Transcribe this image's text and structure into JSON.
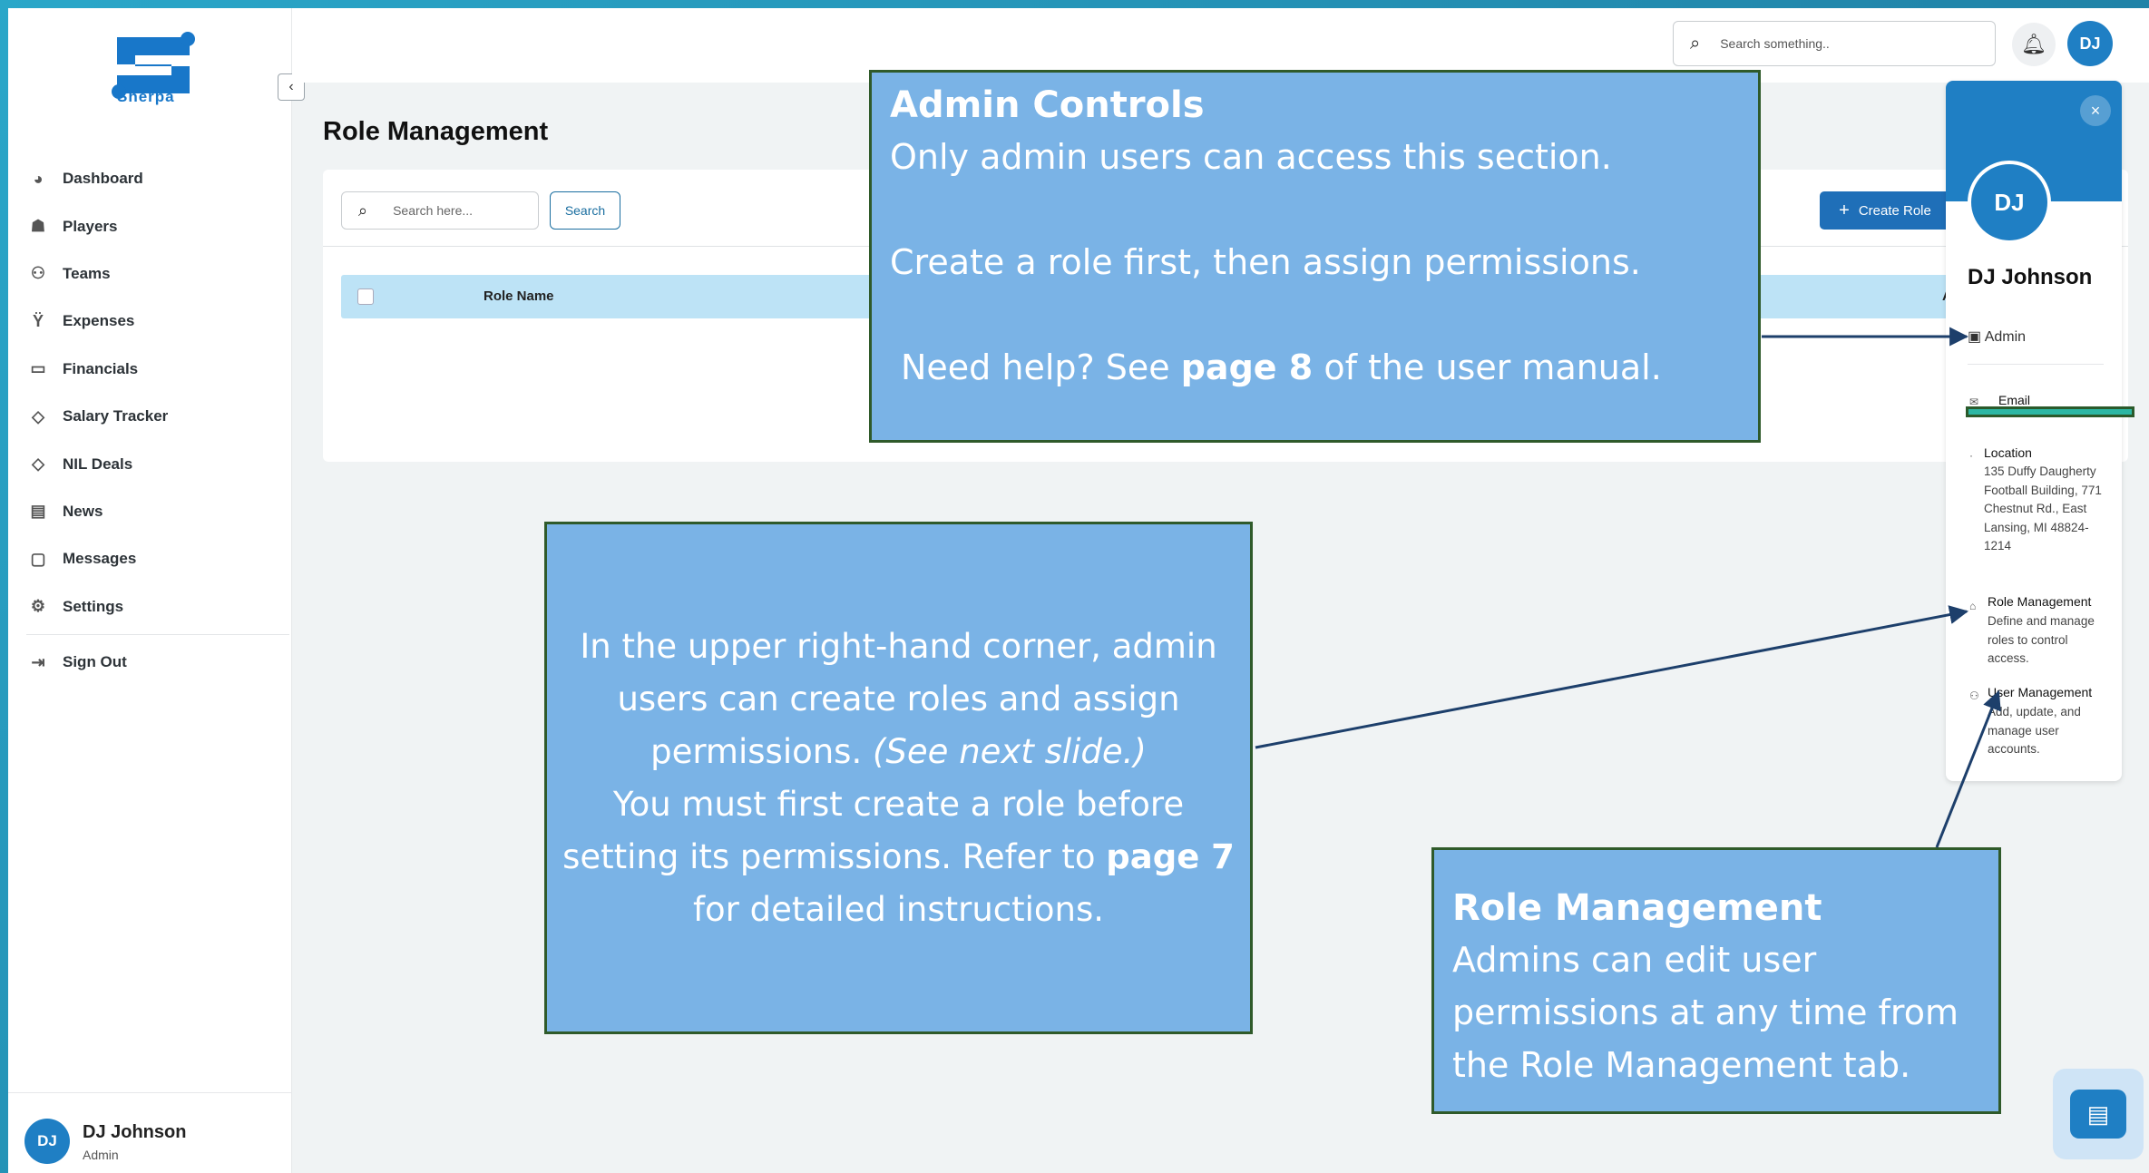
{
  "brand": {
    "name": "Sherpa",
    "color": "#1877c9"
  },
  "sidebar": {
    "collapse_icon": "chevron-left-icon",
    "items": [
      {
        "label": "Dashboard",
        "icon": "dashboard-icon"
      },
      {
        "label": "Players",
        "icon": "players-icon"
      },
      {
        "label": "Teams",
        "icon": "teams-icon"
      },
      {
        "label": "Expenses",
        "icon": "expenses-icon"
      },
      {
        "label": "Financials",
        "icon": "financials-icon"
      },
      {
        "label": "Salary Tracker",
        "icon": "handshake-icon"
      },
      {
        "label": "NIL Deals",
        "icon": "handshake-icon"
      },
      {
        "label": "News",
        "icon": "news-icon"
      },
      {
        "label": "Messages",
        "icon": "messages-icon"
      },
      {
        "label": "Settings",
        "icon": "gear-icon"
      }
    ],
    "sign_out": "Sign Out",
    "user": {
      "initials": "DJ",
      "name": "DJ Johnson",
      "role": "Admin"
    }
  },
  "topbar": {
    "search_placeholder": "Search something..",
    "avatar_initials": "DJ"
  },
  "main": {
    "title": "Role Management",
    "search_placeholder": "Search here...",
    "search_button": "Search",
    "create_button": "Create Role",
    "table": {
      "columns": [
        "Role Name",
        "A"
      ]
    }
  },
  "profile": {
    "initials": "DJ",
    "name": "DJ Johnson",
    "role": "Admin",
    "email_label": "Email",
    "location_label": "Location",
    "location": "135 Duffy Daugherty Football Building, 771 Chestnut Rd., East Lansing, MI 48824-1214",
    "role_mgmt_label": "Role Management",
    "role_mgmt_desc": "Define and manage roles to control access.",
    "user_mgmt_label": "User Management",
    "user_mgmt_desc": "Add, update, and manage user accounts."
  },
  "callouts": {
    "admin": {
      "title": "Admin Controls",
      "line1": "Only admin users can access this section.",
      "line2": "Create a role first, then assign permissions.",
      "line3_pre": "Need help? See ",
      "line3_bold": "page 8",
      "line3_post": " of the user manual."
    },
    "middle": {
      "l1": "In the upper right-hand corner, admin",
      "l2": "users can create roles and assign",
      "l3_pre": "permissions. ",
      "l3_ital1": "(See ",
      "l3_ital2": "next slide",
      "l3_ital3": ".)",
      "l4": "You must first create a role before",
      "l5_pre": "setting its permissions. Refer to ",
      "l5_bold": "page 7",
      "l6": "for detailed instructions."
    },
    "role": {
      "title": "Role Management",
      "l1": "Admins can edit user",
      "l2": "permissions at any time from",
      "l3": "the Role Management tab."
    }
  },
  "chat_icon": "chat-icon"
}
